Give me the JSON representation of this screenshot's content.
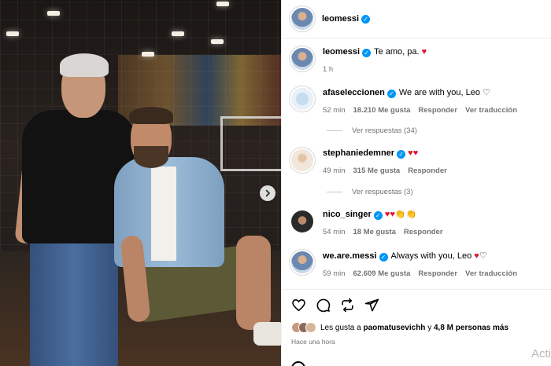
{
  "post": {
    "author": "leomessi",
    "caption_user": "leomessi",
    "caption_text": "Te amo, pa.",
    "caption_time": "1 h"
  },
  "comments": [
    {
      "user": "afaseleccionen",
      "verified": true,
      "text": "We are with you, Leo",
      "hearts": "♡",
      "time": "52 min",
      "likes": "18.210 Me gusta",
      "reply": "Responder",
      "translate": "Ver traducción",
      "replies": "Ver respuestas (34)"
    },
    {
      "user": "stephaniedemner",
      "verified": true,
      "text": "",
      "hearts": "♥♥",
      "time": "49 min",
      "likes": "315 Me gusta",
      "reply": "Responder",
      "translate": "",
      "replies": "Ver respuestas (3)"
    },
    {
      "user": "nico_singer",
      "verified": true,
      "text": "",
      "hearts": "♥♥",
      "claps": "👏👏",
      "time": "54 min",
      "likes": "18 Me gusta",
      "reply": "Responder",
      "translate": "",
      "replies": ""
    },
    {
      "user": "we.are.messi",
      "verified": true,
      "text": "Always with you, Leo",
      "hearts": "♥",
      "hearts_outline": "♡",
      "time": "59 min",
      "likes": "62.609 Me gusta",
      "reply": "Responder",
      "translate": "Ver traducción",
      "replies": ""
    }
  ],
  "likes_bar": {
    "prefix": "Les gusta a",
    "user": "paomatusevichh",
    "connector": "y",
    "others": "4,8 M personas más",
    "time": "Hace una hora"
  },
  "watermark": "Acti",
  "icons": [
    "heart-icon",
    "comment-icon",
    "share-icon",
    "send-icon",
    "chevron-right-icon",
    "verified-icon"
  ],
  "colors": {
    "accent": "#0095f6",
    "heart": "#e0142c",
    "muted": "#737373"
  }
}
